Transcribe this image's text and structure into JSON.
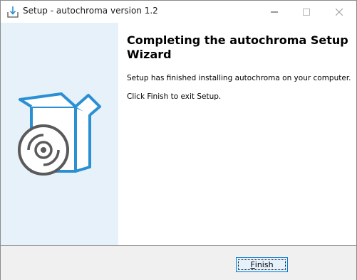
{
  "window": {
    "title": "Setup - autochroma version 1.2",
    "icon": "setup-install-icon",
    "controls": {
      "minimize_icon": "minimize-icon",
      "maximize_icon": "maximize-icon",
      "close_icon": "close-icon"
    }
  },
  "wizard": {
    "heading": "Completing the autochroma Setup Wizard",
    "message": "Setup has finished installing autochroma on your computer.",
    "instruction": "Click Finish to exit Setup.",
    "illustration": "software-box-disc-icon"
  },
  "footer": {
    "finish_mnemonic": "F",
    "finish_rest": "inish"
  },
  "colors": {
    "accent": "#2b8fd3",
    "left_panel": "#e6f1f9",
    "disc_gray": "#5a5a5a",
    "button_border": "#0078d7"
  }
}
